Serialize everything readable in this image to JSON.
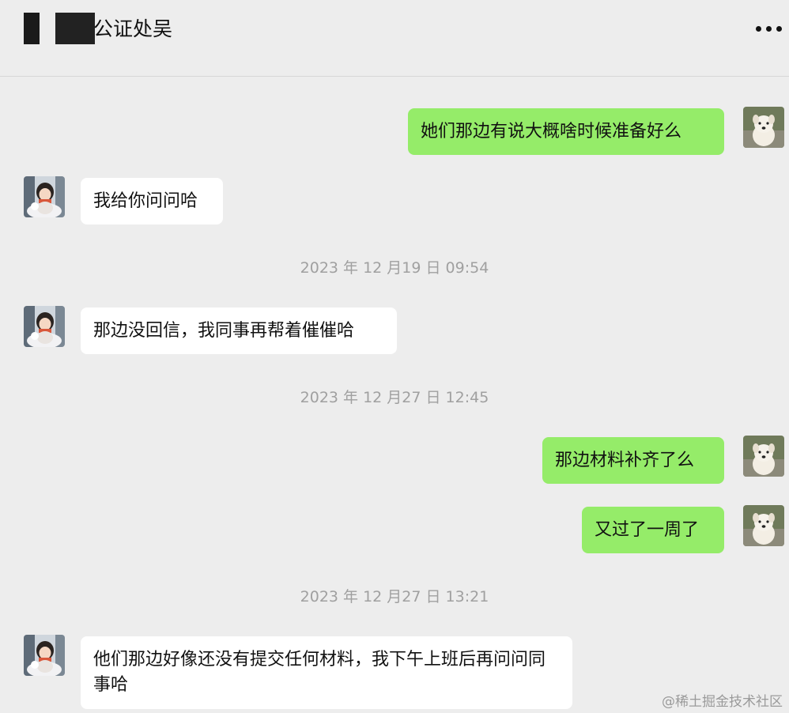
{
  "header": {
    "contact_name": "公证处吴",
    "more_icon": "more-dots-icon"
  },
  "messages": [
    {
      "type": "text",
      "side": "right",
      "text": "她们那边有说大概啥时候准备好么"
    },
    {
      "type": "text",
      "side": "left",
      "text": "我给你问问哈"
    },
    {
      "type": "time",
      "text": "2023 年 12 月19 日 09:54"
    },
    {
      "type": "text",
      "side": "left",
      "text": "那边没回信，我同事再帮着催催哈"
    },
    {
      "type": "time",
      "text": "2023 年 12 月27 日 12:45"
    },
    {
      "type": "text",
      "side": "right",
      "text": "那边材料补齐了么"
    },
    {
      "type": "text",
      "side": "right",
      "text": "又过了一周了"
    },
    {
      "type": "time",
      "text": "2023 年 12 月27 日 13:21"
    },
    {
      "type": "text",
      "side": "left",
      "text": "他们那边好像还没有提交任何材料，我下午上班后再问问同事哈"
    }
  ],
  "watermark": "@稀土掘金技术社区",
  "colors": {
    "background": "#ededed",
    "outgoing_bubble": "#95ec69",
    "incoming_bubble": "#ffffff",
    "timestamp": "#a0a0a0"
  }
}
